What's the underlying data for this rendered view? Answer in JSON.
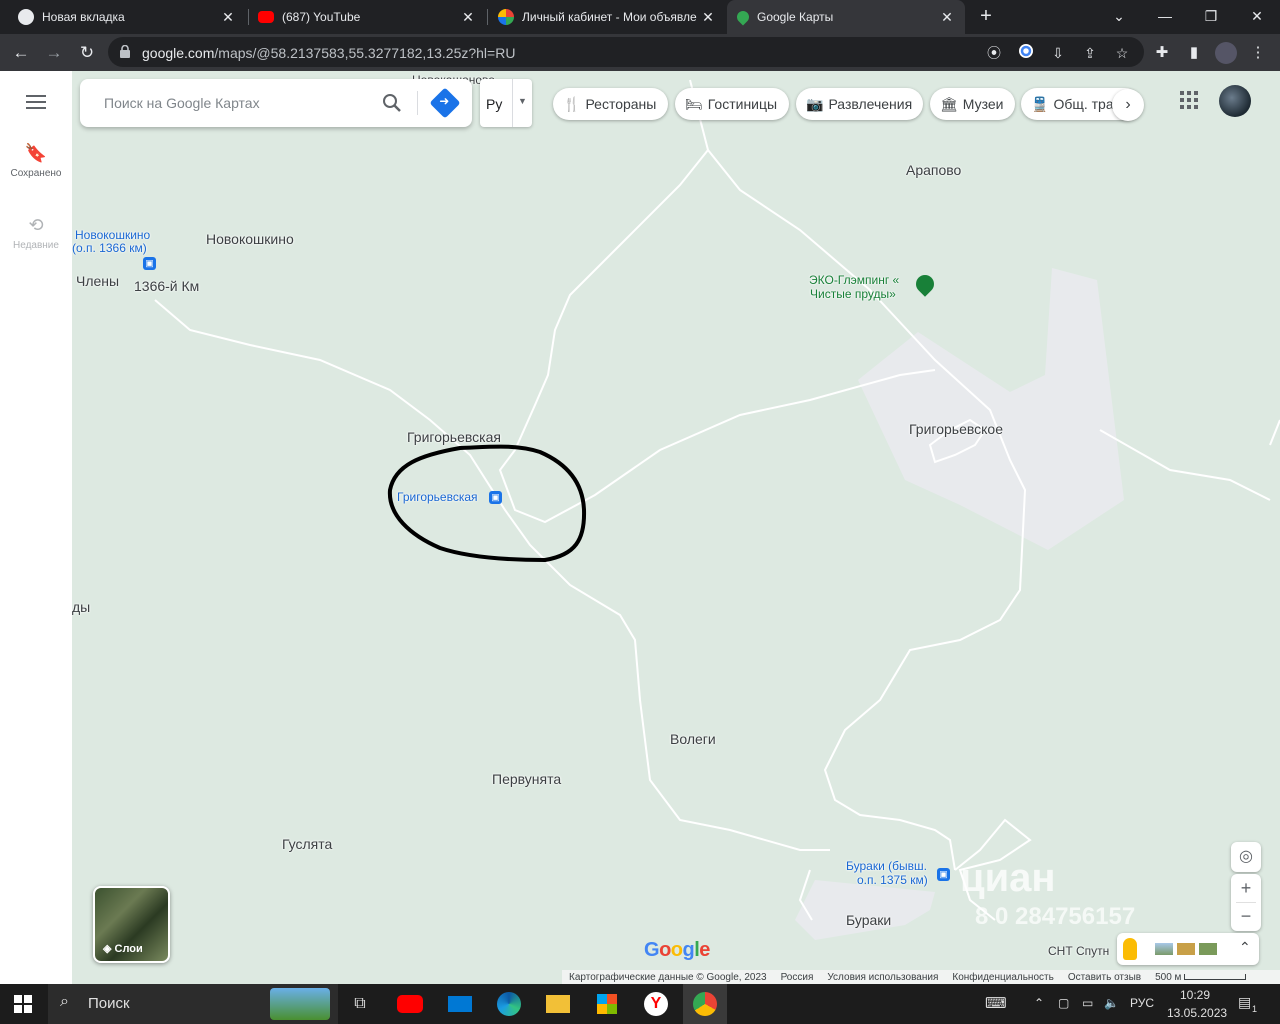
{
  "browser": {
    "tabs": [
      {
        "title": "Новая вкладка",
        "favicon_color": "#e8eaed",
        "active": false
      },
      {
        "title": "(687) YouTube",
        "favicon_color": "#ff0000",
        "active": false
      },
      {
        "title": "Личный кабинет - Мои объявле",
        "favicon_color": "#34a853",
        "active": false
      },
      {
        "title": "Google Карты",
        "favicon_color": "#34a853",
        "active": true
      }
    ],
    "new_tab": "+",
    "url_host": "google.com",
    "url_path": "/maps/@58.2137583,55.3277182,13.25z?hl=RU"
  },
  "maps": {
    "search_placeholder": "Поиск на Google Картах",
    "lang_short": "Ру",
    "rail": {
      "saved": "Сохранено",
      "recent": "Недавние"
    },
    "chips": [
      {
        "label": "Рестораны",
        "icon": "🍴"
      },
      {
        "label": "Гостиницы",
        "icon": "🛏"
      },
      {
        "label": "Развлечения",
        "icon": "📷"
      },
      {
        "label": "Музеи",
        "icon": "🏛"
      },
      {
        "label": "Общ. тра",
        "icon": "🚆"
      }
    ],
    "labels": {
      "novoshanovo": "Новокашаново",
      "arapovo": "Арапово",
      "novokoshkino_stop": "Новокошкино",
      "novokoshkino_stop2": "(о.п. 1366 км)",
      "novokoshkino": "Новокошкино",
      "chleny": "Члены",
      "km1366": "1366-й Км",
      "eco1": "ЭКО-Глэмпинг «",
      "eco2": "Чистые пруды»",
      "grigorevskaya": "Григорьевская",
      "grigorevskaya_stop": "Григорьевская",
      "grigorevskoe": "Григорьевское",
      "prudy": "ды",
      "volegi": "Волеги",
      "pervunyata": "Первунята",
      "guslyata": "Гуслята",
      "buraki_stop1": "Бураки (бывш.",
      "buraki_stop2": "о.п. 1375 км)",
      "buraki": "Бураки",
      "snt": "СНТ Спутн"
    },
    "layers_label": "Слои",
    "logo": "Google",
    "footer": [
      "Картографические данные © Google, 2023",
      "Россия",
      "Условия использования",
      "Конфиденциальность",
      "Оставить отзыв",
      "500 м"
    ],
    "watermark1": "циан",
    "watermark2": "8 0 284756157",
    "colors": {
      "map_bg": "#dde9e1",
      "road": "#ffffff",
      "settlement": "#e8eaed",
      "accent": "#1a73e8"
    }
  },
  "taskbar": {
    "search": "Поиск",
    "lang": "РУС",
    "time": "10:29",
    "date": "13.05.2023",
    "notif": "1"
  }
}
